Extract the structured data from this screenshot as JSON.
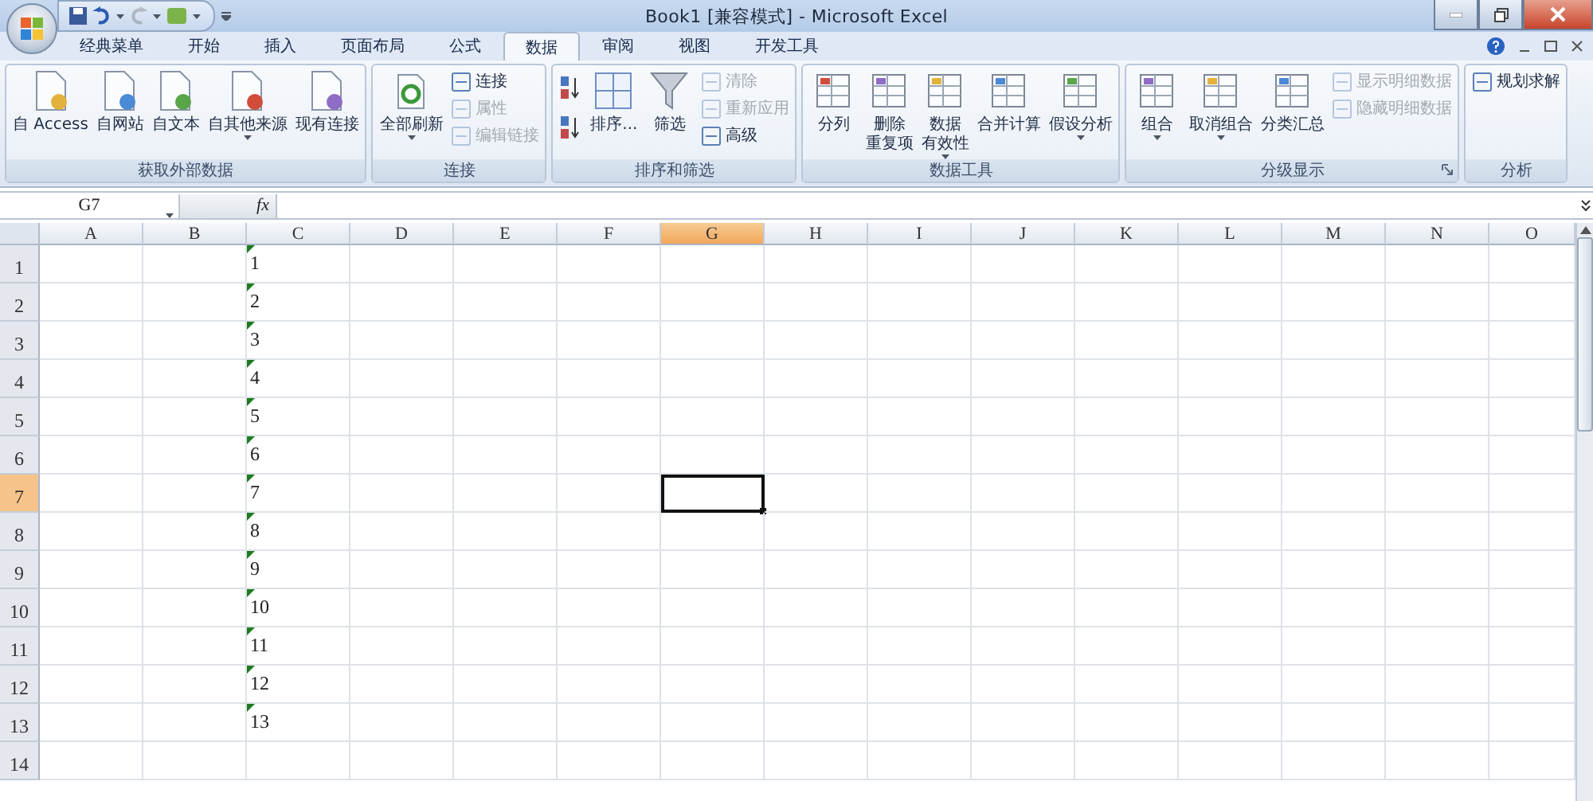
{
  "title_bar": {
    "title": "Book1  [兼容模式] - Microsoft Excel"
  },
  "ribbon": {
    "tabs": [
      {
        "label": "经典菜单",
        "selected": false
      },
      {
        "label": "开始",
        "selected": false
      },
      {
        "label": "插入",
        "selected": false
      },
      {
        "label": "页面布局",
        "selected": false
      },
      {
        "label": "公式",
        "selected": false
      },
      {
        "label": "数据",
        "selected": true
      },
      {
        "label": "审阅",
        "selected": false
      },
      {
        "label": "视图",
        "selected": false
      },
      {
        "label": "开发工具",
        "selected": false
      }
    ],
    "groups": [
      {
        "label": "获取外部数据",
        "dialog_launcher": false,
        "buttons": [
          {
            "kind": "large",
            "label": "自 Access",
            "dropdown": false,
            "disabled": false
          },
          {
            "kind": "large",
            "label": "自网站",
            "dropdown": false,
            "disabled": false
          },
          {
            "kind": "large",
            "label": "自文本",
            "dropdown": false,
            "disabled": false
          },
          {
            "kind": "large",
            "label": "自其他来源",
            "dropdown": true,
            "disabled": false
          },
          {
            "kind": "large",
            "label": "现有连接",
            "dropdown": false,
            "disabled": false
          }
        ]
      },
      {
        "label": "连接",
        "dialog_launcher": false,
        "buttons": [
          {
            "kind": "large",
            "label": "全部刷新",
            "dropdown": true,
            "disabled": false
          },
          {
            "kind": "small",
            "label": "连接",
            "dropdown": false,
            "disabled": false
          },
          {
            "kind": "small",
            "label": "属性",
            "dropdown": false,
            "disabled": true
          },
          {
            "kind": "small",
            "label": "编辑链接",
            "dropdown": false,
            "disabled": true
          }
        ]
      },
      {
        "label": "排序和筛选",
        "dialog_launcher": false,
        "buttons": [
          {
            "kind": "icon",
            "dropdown": false,
            "disabled": false
          },
          {
            "kind": "icon",
            "dropdown": false,
            "disabled": false
          },
          {
            "kind": "large",
            "label": "排序...",
            "dropdown": false,
            "disabled": false
          },
          {
            "kind": "large",
            "label": "筛选",
            "dropdown": false,
            "disabled": false
          },
          {
            "kind": "small",
            "label": "清除",
            "dropdown": false,
            "disabled": true
          },
          {
            "kind": "small",
            "label": "重新应用",
            "dropdown": false,
            "disabled": true
          },
          {
            "kind": "small",
            "label": "高级",
            "dropdown": false,
            "disabled": false
          }
        ]
      },
      {
        "label": "数据工具",
        "dialog_launcher": false,
        "buttons": [
          {
            "kind": "large",
            "label": "分列",
            "dropdown": false,
            "disabled": false
          },
          {
            "kind": "large",
            "lines": [
              "删除",
              "重复项"
            ],
            "dropdown": false,
            "disabled": false
          },
          {
            "kind": "large",
            "lines": [
              "数据",
              "有效性"
            ],
            "dropdown": true,
            "disabled": false
          },
          {
            "kind": "large",
            "label": "合并计算",
            "dropdown": false,
            "disabled": false
          },
          {
            "kind": "large",
            "label": "假设分析",
            "dropdown": true,
            "disabled": false
          }
        ]
      },
      {
        "label": "分级显示",
        "dialog_launcher": true,
        "buttons": [
          {
            "kind": "large",
            "label": "组合",
            "dropdown": true,
            "disabled": false
          },
          {
            "kind": "large",
            "label": "取消组合",
            "dropdown": true,
            "disabled": false
          },
          {
            "kind": "large",
            "label": "分类汇总",
            "dropdown": false,
            "disabled": false
          },
          {
            "kind": "small",
            "label": "显示明细数据",
            "dropdown": false,
            "disabled": true
          },
          {
            "kind": "small",
            "label": "隐藏明细数据",
            "dropdown": false,
            "disabled": true
          }
        ]
      },
      {
        "label": "分析",
        "dialog_launcher": false,
        "buttons": [
          {
            "kind": "small",
            "label": "规划求解",
            "dropdown": false,
            "disabled": false
          }
        ]
      }
    ]
  },
  "formula_bar": {
    "name_box": "G7",
    "function_label": "fx"
  },
  "sheet": {
    "columns": [
      {
        "label": "A",
        "selected": false
      },
      {
        "label": "B",
        "selected": false
      },
      {
        "label": "C",
        "selected": false
      },
      {
        "label": "D",
        "selected": false
      },
      {
        "label": "E",
        "selected": false
      },
      {
        "label": "F",
        "selected": false
      },
      {
        "label": "G",
        "selected": true
      },
      {
        "label": "H",
        "selected": false
      },
      {
        "label": "I",
        "selected": false
      },
      {
        "label": "J",
        "selected": false
      },
      {
        "label": "K",
        "selected": false
      },
      {
        "label": "L",
        "selected": false
      },
      {
        "label": "M",
        "selected": false
      },
      {
        "label": "N",
        "selected": false
      },
      {
        "label": "O",
        "selected": false
      }
    ],
    "rows": [
      {
        "label": "1",
        "selected": false,
        "column_c": {
          "value": "1",
          "flagged": true
        }
      },
      {
        "label": "2",
        "selected": false,
        "column_c": {
          "value": "2",
          "flagged": true
        }
      },
      {
        "label": "3",
        "selected": false,
        "column_c": {
          "value": "3",
          "flagged": true
        }
      },
      {
        "label": "4",
        "selected": false,
        "column_c": {
          "value": "4",
          "flagged": true
        }
      },
      {
        "label": "5",
        "selected": false,
        "column_c": {
          "value": "5",
          "flagged": true
        }
      },
      {
        "label": "6",
        "selected": false,
        "column_c": {
          "value": "6",
          "flagged": true
        }
      },
      {
        "label": "7",
        "selected": true,
        "column_c": {
          "value": "7",
          "flagged": true
        }
      },
      {
        "label": "8",
        "selected": false,
        "column_c": {
          "value": "8",
          "flagged": true
        }
      },
      {
        "label": "9",
        "selected": false,
        "column_c": {
          "value": "9",
          "flagged": true
        }
      },
      {
        "label": "10",
        "selected": false,
        "column_c": {
          "value": "10",
          "flagged": true
        }
      },
      {
        "label": "11",
        "selected": false,
        "column_c": {
          "value": "11",
          "flagged": true
        }
      },
      {
        "label": "12",
        "selected": false,
        "column_c": {
          "value": "12",
          "flagged": true
        }
      },
      {
        "label": "13",
        "selected": false,
        "column_c": {
          "value": "13",
          "flagged": true
        }
      },
      {
        "label": "14",
        "selected": false
      }
    ]
  }
}
